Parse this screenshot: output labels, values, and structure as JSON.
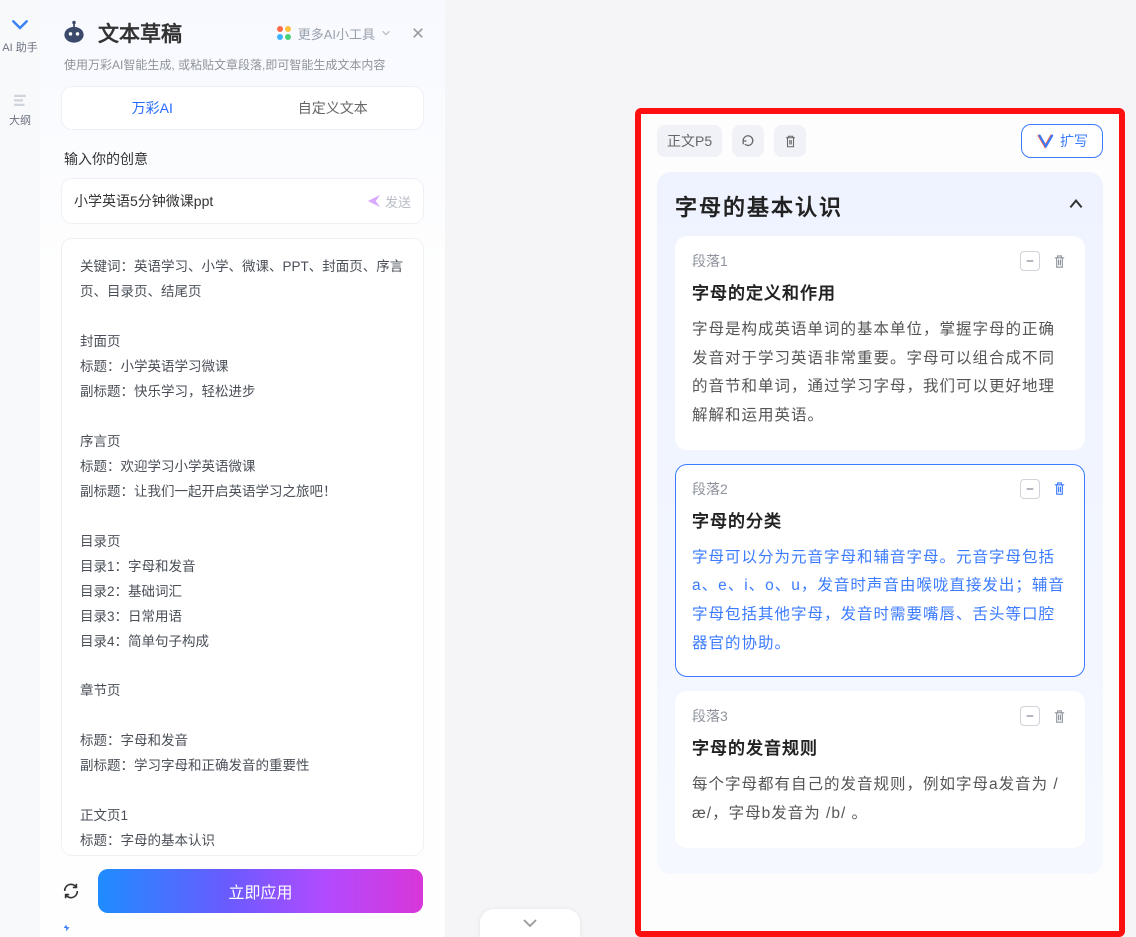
{
  "left_rail": {
    "items": [
      {
        "label": "AI 助手",
        "icon": "ai-assistant-icon"
      },
      {
        "label": "大纲",
        "icon": "outline-icon"
      }
    ]
  },
  "sidebar": {
    "title": "文本草稿",
    "subtitle": "使用万彩AI智能生成, 或粘贴文章段落,即可智能生成文本内容",
    "more_tools": "更多AI小工具",
    "tabs": {
      "wancai": "万彩AI",
      "custom": "自定义文本"
    },
    "input_label": "输入你的创意",
    "input_value": "小学英语5分钟微课ppt",
    "send_label": "发送",
    "content_text": "关键词：英语学习、小学、微课、PPT、封面页、序言页、目录页、结尾页\n\n封面页\n标题：小学英语学习微课\n副标题：快乐学习，轻松进步\n\n序言页\n标题：欢迎学习小学英语微课\n副标题：让我们一起开启英语学习之旅吧！\n\n目录页\n目录1：字母和发音\n目录2：基础词汇\n目录3：日常用语\n目录4：简单句子构成\n\n章节页\n\n标题：字母和发音\n副标题：学习字母和正确发音的重要性\n\n正文页1\n标题：字母的基本认识\n小标题：字母的定义和作用\n正文：字母是构成英语单词的基本单位，掌握字母的正确发音对于学习英语非常重要。字母可以组合成不同的音节和单词，通过学习字母，我们可以更好地理解和运用英语。",
    "apply_label": "立即应用"
  },
  "right_panel": {
    "page_badge": "正文P5",
    "expand_label": "扩写",
    "section_title": "字母的基本认识",
    "paragraphs": [
      {
        "label": "段落1",
        "title": "字母的定义和作用",
        "body": "字母是构成英语单词的基本单位，掌握字母的正确发音对于学习英语非常重要。字母可以组合成不同的音节和单词，通过学习字母，我们可以更好地理解解和运用英语。"
      },
      {
        "label": "段落2",
        "title": "字母的分类",
        "body": "字母可以分为元音字母和辅音字母。元音字母包括a、e、i、o、u，发音时声音由喉咙直接发出；辅音字母包括其他字母，发音时需要嘴唇、舌头等口腔器官的协助。"
      },
      {
        "label": "段落3",
        "title": "字母的发音规则",
        "body": "每个字母都有自己的发音规则，例如字母a发音为 /æ/，字母b发音为 /b/ 。"
      }
    ]
  }
}
